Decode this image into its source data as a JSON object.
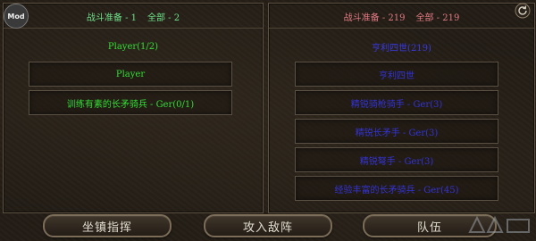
{
  "mod_badge": "Mod",
  "left": {
    "header": {
      "ready": "战斗准备 - 1",
      "total": "全部 - 2"
    },
    "group_title": "Player(1/2)",
    "rows": [
      "Player",
      "训练有素的长矛骑兵 - Ger(0/1)"
    ]
  },
  "right": {
    "header": {
      "ready": "战斗准备 - 219",
      "total": "全部 - 219"
    },
    "group_title": "亨利四世(219)",
    "rows": [
      "亨利四世",
      "精锐骑枪骑手 - Ger(3)",
      "精锐长矛手 - Ger(3)",
      "精锐弩手 - Ger(3)",
      "经验丰富的长矛骑兵 - Ger(45)"
    ]
  },
  "buttons": {
    "command": "坐镇指挥",
    "attack": "攻入敌阵",
    "formation": "队伍"
  },
  "colors": {
    "left_text": "#33dd33",
    "right_text": "#3333d6",
    "left_header": "#6fe08a",
    "right_header": "#e27a82"
  }
}
